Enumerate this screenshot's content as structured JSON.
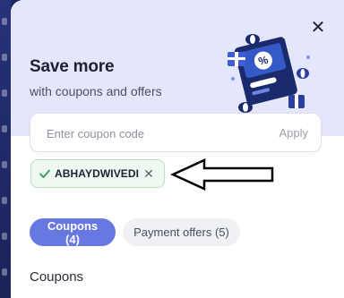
{
  "header": {
    "close_icon": "close-icon",
    "title": "Save more",
    "subtitle": "with coupons and offers",
    "illustration": "coupon-gift-illustration"
  },
  "coupon_entry": {
    "placeholder": "Enter coupon code",
    "value": "",
    "apply_label": "Apply"
  },
  "applied_coupon": {
    "code": "ABHAYDWIVEDI",
    "status_icon": "check-icon",
    "remove_icon": "close-icon"
  },
  "tabs": [
    {
      "label": "Coupons (4)",
      "active": true
    },
    {
      "label": "Payment offers (5)",
      "active": false
    }
  ],
  "section": {
    "heading": "Coupons"
  },
  "colors": {
    "hero_background": "#e4e7fb",
    "accent": "#6878e3",
    "chip_background": "#eef8f1",
    "chip_border": "#b9dfc5",
    "check": "#2e9e5b",
    "backdrop": "#1f2a63"
  }
}
